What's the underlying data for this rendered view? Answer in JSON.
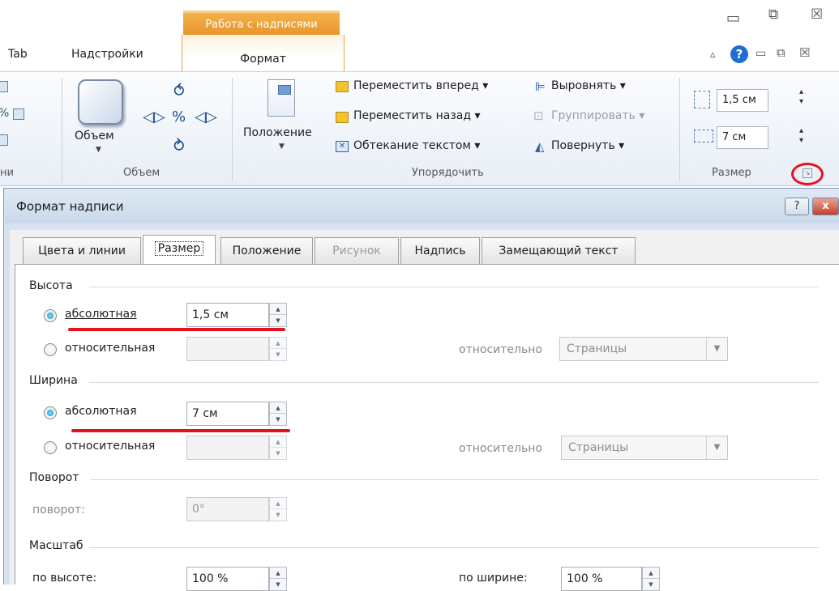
{
  "ribbon": {
    "context_tab": "Работа с надписями",
    "tabs": [
      "Tab",
      "Надстройки",
      "Формат"
    ],
    "window_controls": [
      "minimize",
      "restore",
      "close"
    ],
    "inner_controls": [
      "collapse",
      "help",
      "minimize",
      "restore",
      "close"
    ],
    "groups": {
      "partial_label": "ни",
      "volume": {
        "button": "Объем",
        "label": "Объем"
      },
      "arrange": {
        "position": "Положение",
        "bring_forward": "Переместить вперед",
        "send_backward": "Переместить назад",
        "wrap_text": "Обтекание текстом",
        "align": "Выровнять",
        "group": "Группировать",
        "rotate": "Повернуть",
        "label": "Упорядочить"
      },
      "size": {
        "height": "1,5 см",
        "width": "7 см",
        "label": "Размер"
      }
    }
  },
  "dialog": {
    "title": "Формат надписи",
    "help_btn": "?",
    "close_btn": "x",
    "tabs": [
      "Цвета и линии",
      "Размер",
      "Положение",
      "Рисунок",
      "Надпись",
      "Замещающий текст"
    ],
    "height_section": {
      "title": "Высота",
      "absolute_label": "абсолютная",
      "absolute_value": "1,5 см",
      "relative_label": "относительная",
      "relative_value": "",
      "relative_to_label": "относительно",
      "relative_to_value": "Страницы"
    },
    "width_section": {
      "title": "Ширина",
      "absolute_label": "абсолютная",
      "absolute_value": "7 см",
      "relative_label": "относительная",
      "relative_value": "",
      "relative_to_label": "относительно",
      "relative_to_value": "Страницы"
    },
    "rotation_section": {
      "title": "Поворот",
      "rotation_label": "поворот:",
      "rotation_value": "0°"
    },
    "scale_section": {
      "title": "Масштаб",
      "height_label": "по высоте:",
      "height_value": "100 %",
      "width_label": "по ширине:",
      "width_value": "100 %"
    }
  }
}
